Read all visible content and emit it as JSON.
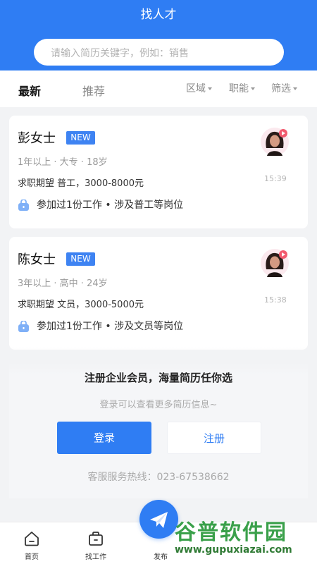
{
  "header": {
    "title": "找人才"
  },
  "search": {
    "placeholder": "请输入简历关键字，例如：销售"
  },
  "tabs": {
    "active": "最新",
    "inactive": "推荐"
  },
  "filters": [
    "区域",
    "职能",
    "筛选"
  ],
  "candidates": [
    {
      "name": "彭女士",
      "badge": "NEW",
      "meta": "1年以上 · 大专 · 18岁",
      "expectation": "求职期望 普工，3000-8000元",
      "experience": "参加过1份工作 • 涉及普工等岗位",
      "time": "15:39"
    },
    {
      "name": "陈女士",
      "badge": "NEW",
      "meta": "3年以上 · 高中 · 24岁",
      "expectation": "求职期望 文员，3000-5000元",
      "experience": "参加过1份工作 • 涉及文员等岗位",
      "time": "15:38"
    }
  ],
  "promo": {
    "title": "注册企业会员，海量简历任你选",
    "subtitle": "登录可以查看更多简历信息~",
    "login_label": "登录",
    "register_label": "注册",
    "hotline": "客服服务热线：023-67538662"
  },
  "nav": {
    "items": [
      "首页",
      "找工作",
      "发布"
    ]
  },
  "watermark": {
    "text": "谷普软件园",
    "url": "www.gupuxiazai.com"
  },
  "colors": {
    "primary": "#2f7df3",
    "badge": "#3e83f2",
    "watermark": "#3aa04a"
  }
}
